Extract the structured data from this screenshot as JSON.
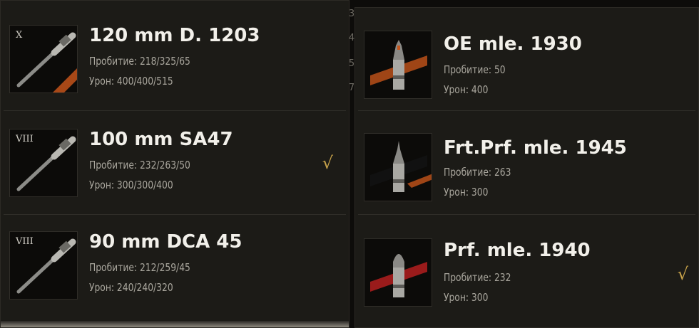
{
  "guns": [
    {
      "tier": "X",
      "name": "120 mm D. 1203",
      "pen_label": "Пробитие:",
      "pen": "218/325/65",
      "dmg_label": "Урон:",
      "dmg": "400/400/515",
      "selected": false
    },
    {
      "tier": "VIII",
      "name": "100 mm SA47",
      "pen_label": "Пробитие:",
      "pen": "232/263/50",
      "dmg_label": "Урон:",
      "dmg": "300/300/400",
      "selected": true
    },
    {
      "tier": "VIII",
      "name": "90 mm DCA 45",
      "pen_label": "Пробитие:",
      "pen": "212/259/45",
      "dmg_label": "Урон:",
      "dmg": "240/240/320",
      "selected": false
    }
  ],
  "shells": [
    {
      "name": "OE mle. 1930",
      "pen_label": "Пробитие:",
      "pen": "50",
      "dmg_label": "Урон:",
      "dmg": "400",
      "selected": false
    },
    {
      "name": "Frt.Prf. mle. 1945",
      "pen_label": "Пробитие:",
      "pen": "263",
      "dmg_label": "Урон:",
      "dmg": "300",
      "selected": false
    },
    {
      "name": "Prf. mle. 1940",
      "pen_label": "Пробитие:",
      "pen": "232",
      "dmg_label": "Урон:",
      "dmg": "300",
      "selected": true
    }
  ],
  "checkmark": "√",
  "stray_digits": [
    "3",
    "4",
    "5",
    "7"
  ],
  "colors": {
    "panel_bg": "#1c1b17",
    "title": "#f2f0ea",
    "stat": "#a9a69d",
    "check": "#c8a34a",
    "stripe_orange": "#c4541a",
    "stripe_red": "#b41e1e",
    "stripe_dark": "#1e1e1e"
  },
  "icons": {
    "gun": "gun-barrel-icon",
    "shell_he": "he-shell-icon",
    "shell_heat": "heat-shell-icon",
    "shell_ap": "ap-shell-icon",
    "check": "checkmark-icon"
  }
}
